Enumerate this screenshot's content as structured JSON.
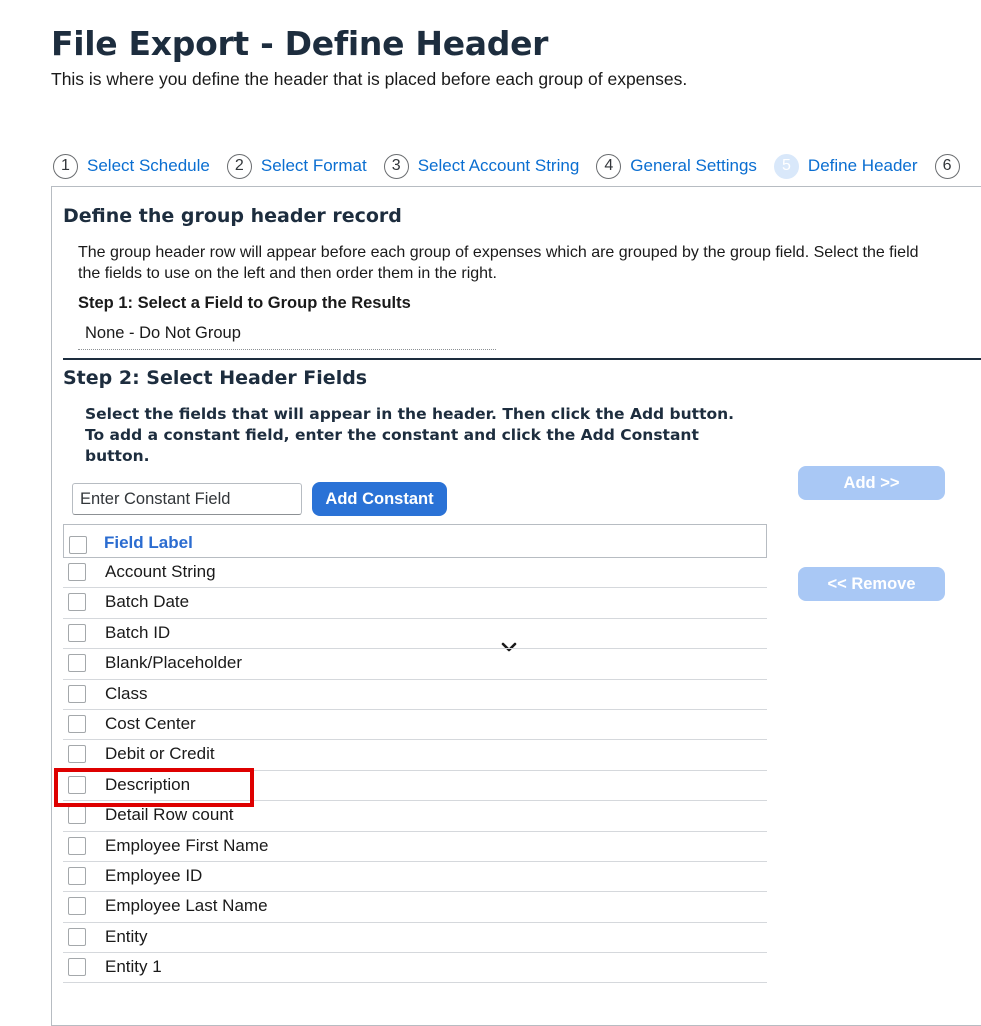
{
  "page": {
    "title": "File Export - Define Header",
    "subtitle": "This is where you define the header that is placed before each group of expenses."
  },
  "wizard": {
    "steps": [
      {
        "number": "1",
        "label": "Select Schedule",
        "active": false
      },
      {
        "number": "2",
        "label": "Select Format",
        "active": false
      },
      {
        "number": "3",
        "label": "Select Account String",
        "active": false
      },
      {
        "number": "4",
        "label": "General Settings",
        "active": false
      },
      {
        "number": "5",
        "label": "Define Header",
        "active": true
      },
      {
        "number": "6",
        "label": "",
        "active": false
      }
    ]
  },
  "group_section": {
    "title": "Define the group header record",
    "description_line1": "The group header row will appear before each group of expenses which are grouped by the group field. Select the field",
    "description_line2": "the fields to use on the left and then order them in the right.",
    "step1_label": "Step 1: Select a Field to Group the Results",
    "group_select_value": "None - Do Not Group"
  },
  "header_fields": {
    "title": "Step 2: Select Header Fields",
    "instruction_line1": "Select the fields that will appear in the header. Then click the Add button.",
    "instruction_line2": "To add a constant field, enter the constant and click the Add Constant",
    "instruction_line3": "button.",
    "constant_placeholder": "Enter Constant Field",
    "add_constant_label": "Add Constant",
    "add_label": "Add >>",
    "remove_label": "<< Remove",
    "column_header": "Field Label",
    "rows": [
      "Account String",
      "Batch Date",
      "Batch ID",
      "Blank/Placeholder",
      "Class",
      "Cost Center",
      "Debit or Credit",
      "Description",
      "Detail Row count",
      "Employee First Name",
      "Employee ID",
      "Employee Last Name",
      "Entity",
      "Entity 1"
    ]
  },
  "colors": {
    "primary_button": "#2a72d6",
    "disabled_button": "#a9c8f5",
    "link": "#0a6ed1",
    "highlight_box": "#de0000"
  }
}
